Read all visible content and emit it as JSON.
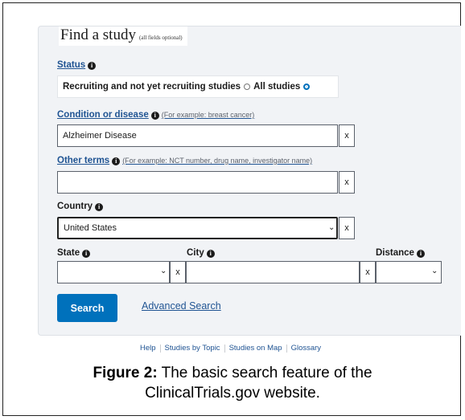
{
  "form": {
    "heading": "Find a study",
    "heading_note": "(all fields optional)",
    "status": {
      "label": "Status",
      "option_recruiting": "Recruiting and not yet recruiting studies",
      "option_all": "All studies",
      "selected": "All studies"
    },
    "condition": {
      "label": "Condition or disease",
      "hint": "(For example: breast cancer)",
      "value": "Alzheimer Disease",
      "clear": "x"
    },
    "other_terms": {
      "label": "Other terms",
      "hint": "(For example: NCT number, drug name, investigator name)",
      "value": "",
      "clear": "x"
    },
    "country": {
      "label": "Country",
      "value": "United States",
      "clear": "x"
    },
    "state": {
      "label": "State",
      "value": "",
      "clear": "x"
    },
    "city": {
      "label": "City",
      "value": "",
      "clear": "x"
    },
    "distance": {
      "label": "Distance",
      "value": ""
    },
    "search_button": "Search",
    "advanced_link": "Advanced Search"
  },
  "footer_links": [
    "Help",
    "Studies by Topic",
    "Studies on Map",
    "Glossary"
  ],
  "caption": {
    "prefix": "Figure 2:",
    "line1": " The basic search feature of the",
    "line2": "ClinicalTrials.gov website."
  },
  "colors": {
    "accent": "#0071bc",
    "link": "#205493",
    "panel": "#f1f3f6"
  },
  "icons": {
    "info": "info-circle-icon",
    "chevron": "chevron-down-icon",
    "radio_checked": "radio-checked-icon"
  }
}
